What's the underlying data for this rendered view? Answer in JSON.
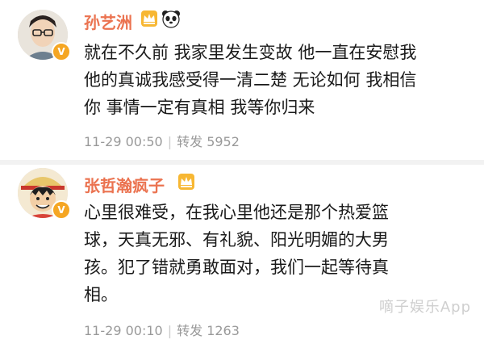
{
  "posts": [
    {
      "username": "孙艺洲",
      "verified_badge": "V",
      "badge_icons": [
        "crown-icon",
        "panda-icon"
      ],
      "content_lines": [
        "就在不久前 我家里发生变故 他一直在安慰我",
        "他的真诚我感受得一清二楚 无论如何 我相信",
        "你 事情一定有真相 我等你归来"
      ],
      "timestamp": "11-29 00:50",
      "repost_label": "转发",
      "repost_count": "5952"
    },
    {
      "username": "张哲瀚疯子",
      "verified_badge": "V",
      "badge_icons": [
        "crown-icon"
      ],
      "content_lines": [
        "心里很难受，在我心里他还是那个热爱篮",
        "球，天真无邪、有礼貌、阳光明媚的大男",
        "孩。犯了错就勇敢面对，我们一起等待真",
        "相。"
      ],
      "timestamp": "11-29 00:10",
      "repost_label": "转发",
      "repost_count": "1263"
    }
  ],
  "watermark": "嘀子娱乐App",
  "colors": {
    "username": "#eb7350",
    "meta": "#999999",
    "badge": "#f5a623",
    "divider": "#f2f2f2"
  }
}
